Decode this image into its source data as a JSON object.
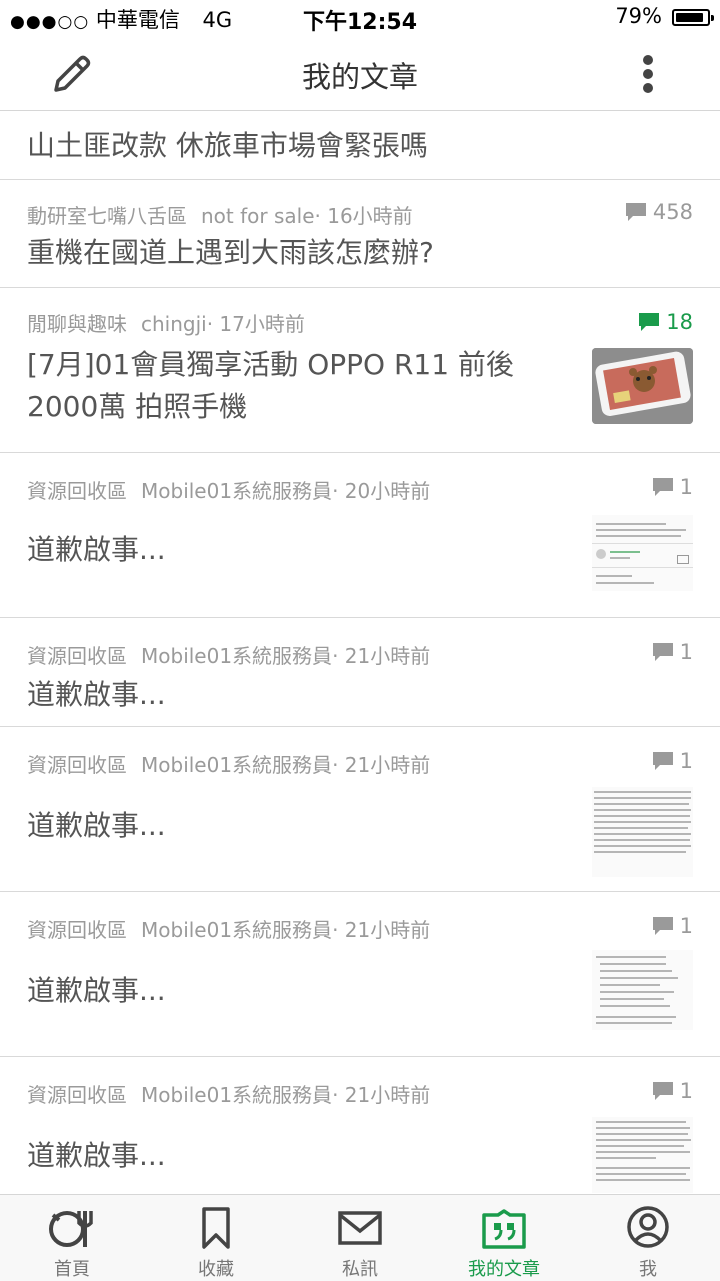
{
  "status_bar": {
    "signal": "●●●○○",
    "carrier": "中華電信",
    "network": "4G",
    "time": "下午12:54",
    "battery": "79%"
  },
  "navbar": {
    "title": "我的文章"
  },
  "posts": [
    {
      "forum": "",
      "author": "",
      "time": "",
      "title": "山土匪改款 休旅車市場會緊張嗎",
      "count": ""
    },
    {
      "forum": "動研室七嘴八舌區",
      "author": "not for sale",
      "time": "· 16小時前",
      "title": "重機在國道上遇到大雨該怎麼辦?",
      "count": "458"
    },
    {
      "forum": "閒聊與趣味",
      "author": "chingji",
      "time": "· 17小時前",
      "title_line1": "[7月]01會員獨享活動 OPPO R11 前後",
      "title_line2": "2000萬 拍照手機",
      "count": "18"
    },
    {
      "forum": "資源回收區",
      "author": "Mobile01系統服務員",
      "time": "· 20小時前",
      "title": "道歉啟事...",
      "count": "1"
    },
    {
      "forum": "資源回收區",
      "author": "Mobile01系統服務員",
      "time": "· 21小時前",
      "title": "道歉啟事...",
      "count": "1"
    },
    {
      "forum": "資源回收區",
      "author": "Mobile01系統服務員",
      "time": "· 21小時前",
      "title": "道歉啟事...",
      "count": "1"
    },
    {
      "forum": "資源回收區",
      "author": "Mobile01系統服務員",
      "time": "· 21小時前",
      "title": "道歉啟事...",
      "count": "1"
    },
    {
      "forum": "資源回收區",
      "author": "Mobile01系統服務員",
      "time": "· 21小時前",
      "title": "道歉啟事...",
      "count": "1"
    }
  ],
  "tabbar": {
    "tabs": [
      {
        "label": "首頁",
        "icon": "home-icon"
      },
      {
        "label": "收藏",
        "icon": "bookmark-icon"
      },
      {
        "label": "私訊",
        "icon": "mail-icon"
      },
      {
        "label": "我的文章",
        "icon": "my-posts-icon",
        "active": true
      },
      {
        "label": "我",
        "icon": "profile-icon"
      }
    ]
  },
  "colors": {
    "accent_green": "#1a9b4b",
    "meta_gray": "#9a9a9a",
    "title_gray": "#555555"
  }
}
